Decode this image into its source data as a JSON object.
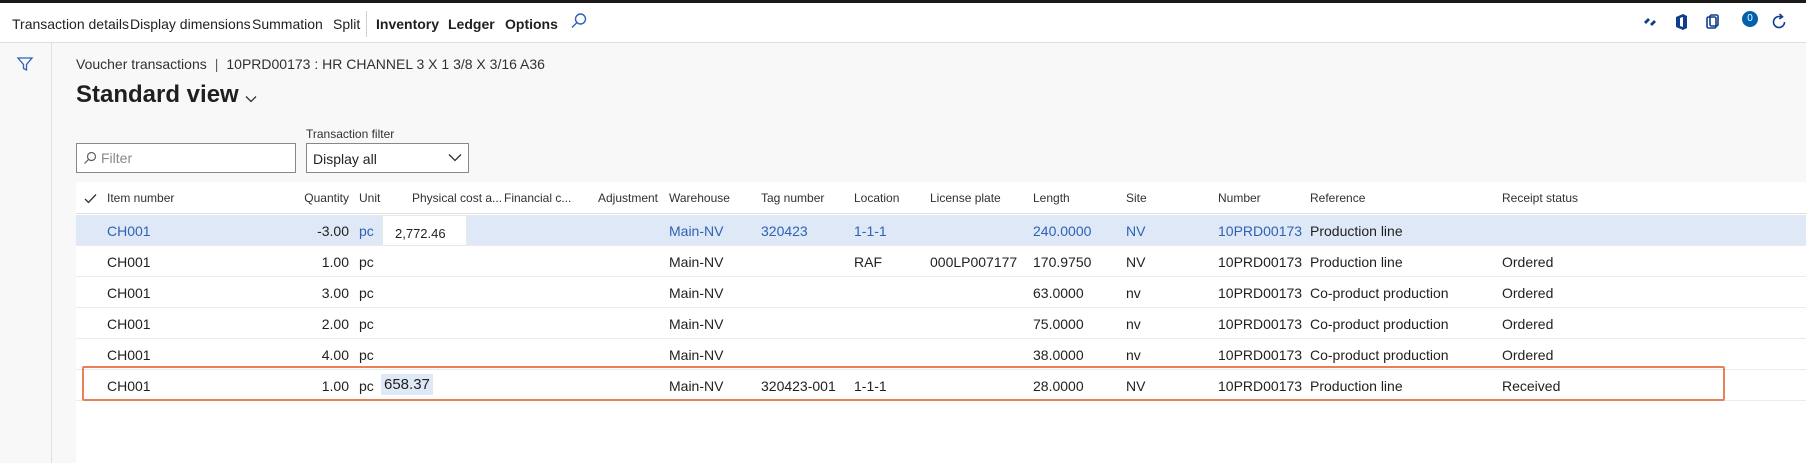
{
  "toolbar": {
    "items": [
      "Transaction details",
      "Display dimensions",
      "Summation",
      "Split",
      "Inventory",
      "Ledger",
      "Options"
    ],
    "notification_count": "0"
  },
  "breadcrumb": {
    "parent": "Voucher transactions",
    "separator": "|",
    "record": "10PRD00173 : HR CHANNEL 3 X 1 3/8 X 3/16 A36"
  },
  "view": {
    "title": "Standard view"
  },
  "filter": {
    "placeholder": "Filter"
  },
  "transaction_filter": {
    "label": "Transaction filter",
    "value": "Display all"
  },
  "grid": {
    "columns": [
      "Item number",
      "Quantity",
      "Unit",
      "Physical cost a...",
      "Financial c...",
      "Adjustment",
      "Warehouse",
      "Tag number",
      "Location",
      "License plate",
      "Length",
      "Site",
      "Number",
      "Reference",
      "Receipt status"
    ],
    "rows": [
      {
        "item": "CH001",
        "qty": "-3.00",
        "unit": "pc",
        "phys": "2,772.46",
        "fin": "",
        "adj": "",
        "wh": "Main-NV",
        "tag": "320423",
        "loc": "1-1-1",
        "lp": "",
        "len": "240.0000",
        "site": "NV",
        "num": "10PRD00173",
        "ref": "Production line",
        "status": ""
      },
      {
        "item": "CH001",
        "qty": "1.00",
        "unit": "pc",
        "phys": "",
        "fin": "",
        "adj": "",
        "wh": "Main-NV",
        "tag": "",
        "loc": "RAF",
        "lp": "000LP007177",
        "len": "170.9750",
        "site": "NV",
        "num": "10PRD00173",
        "ref": "Production line",
        "status": "Ordered"
      },
      {
        "item": "CH001",
        "qty": "3.00",
        "unit": "pc",
        "phys": "",
        "fin": "",
        "adj": "",
        "wh": "Main-NV",
        "tag": "",
        "loc": "",
        "lp": "",
        "len": "63.0000",
        "site": "nv",
        "num": "10PRD00173",
        "ref": "Co-product production",
        "status": "Ordered"
      },
      {
        "item": "CH001",
        "qty": "2.00",
        "unit": "pc",
        "phys": "",
        "fin": "",
        "adj": "",
        "wh": "Main-NV",
        "tag": "",
        "loc": "",
        "lp": "",
        "len": "75.0000",
        "site": "nv",
        "num": "10PRD00173",
        "ref": "Co-product production",
        "status": "Ordered"
      },
      {
        "item": "CH001",
        "qty": "4.00",
        "unit": "pc",
        "phys": "",
        "fin": "",
        "adj": "",
        "wh": "Main-NV",
        "tag": "",
        "loc": "",
        "lp": "",
        "len": "38.0000",
        "site": "nv",
        "num": "10PRD00173",
        "ref": "Co-product production",
        "status": "Ordered"
      },
      {
        "item": "CH001",
        "qty": "1.00",
        "unit": "pc",
        "phys": "658.37",
        "fin": "",
        "adj": "",
        "wh": "Main-NV",
        "tag": "320423-001",
        "loc": "1-1-1",
        "lp": "",
        "len": "28.0000",
        "site": "NV",
        "num": "10PRD00173",
        "ref": "Production line",
        "status": "Received"
      }
    ]
  },
  "colors": {
    "accent": "#2d62b4",
    "selected_row": "#dee8f7",
    "highlight_border": "#e8805a"
  }
}
